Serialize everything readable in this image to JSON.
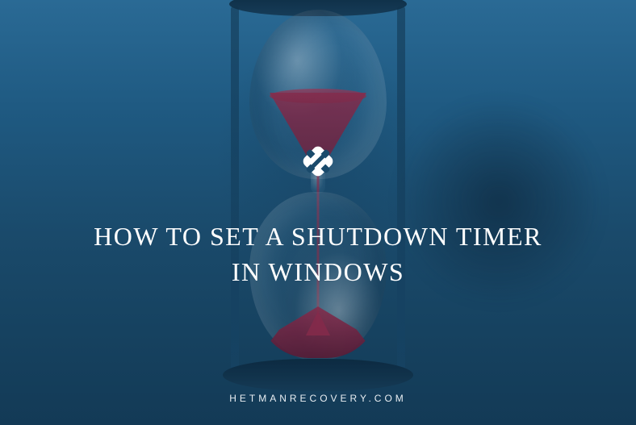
{
  "logo": {
    "name": "hetman-logo-icon"
  },
  "heading": "HOW TO SET A SHUTDOWN TIMER IN WINDOWS",
  "brand": "HETMANRECOVERY.COM",
  "colors": {
    "overlay": "#1a4a6b",
    "text": "#ffffff",
    "sand": "#8a2a4a"
  }
}
